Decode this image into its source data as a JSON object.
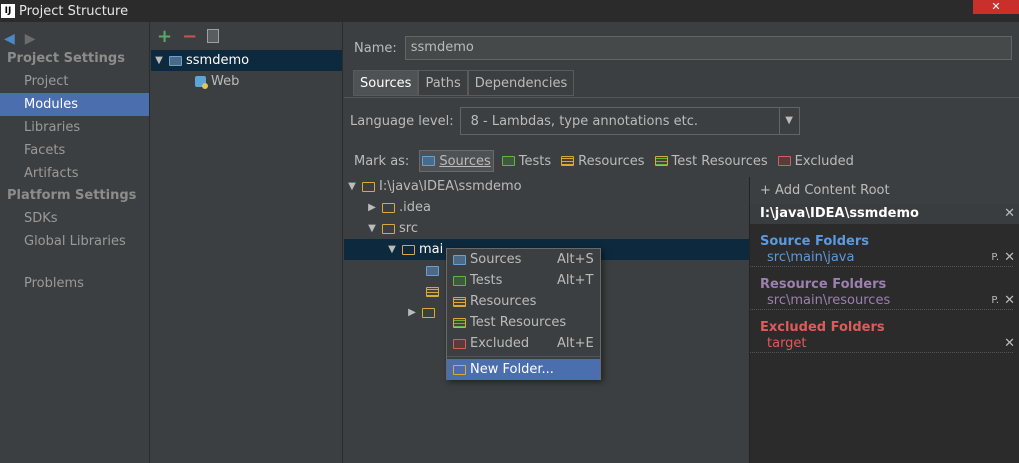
{
  "window": {
    "title": "Project Structure",
    "logo": "IJ",
    "close": "✕"
  },
  "left_nav": {
    "sections": [
      {
        "title": "Project Settings",
        "items": [
          "Project",
          "Modules",
          "Libraries",
          "Facets",
          "Artifacts"
        ]
      },
      {
        "title": "Platform Settings",
        "items": [
          "SDKs",
          "Global Libraries"
        ]
      }
    ],
    "extra": "Problems",
    "active": "Modules"
  },
  "modules": {
    "root": "ssmdemo",
    "child": "Web"
  },
  "main": {
    "name_label": "Name:",
    "name_value": "ssmdemo",
    "tabs": [
      "Sources",
      "Paths",
      "Dependencies"
    ],
    "active_tab": "Sources",
    "language_label": "Language level:",
    "language_value": "8 - Lambdas, type annotations etc.",
    "mark_as_label": "Mark as:",
    "mark_buttons": [
      "Sources",
      "Tests",
      "Resources",
      "Test Resources",
      "Excluded"
    ]
  },
  "source_tree": {
    "root": "I:\\java\\IDEA\\ssmdemo",
    "idea": ".idea",
    "src": "src",
    "main": "mai"
  },
  "content_root": {
    "add_label": "+ Add Content Root",
    "path": "I:\\java\\IDEA\\ssmdemo",
    "source_title": "Source Folders",
    "source_entry": "src\\main\\java",
    "resource_title": "Resource Folders",
    "resource_entry": "src\\main\\resources",
    "excluded_title": "Excluded Folders",
    "excluded_entry": "target"
  },
  "context_menu": {
    "items": [
      {
        "label": "Sources",
        "shortcut": "Alt+S"
      },
      {
        "label": "Tests",
        "shortcut": "Alt+T"
      },
      {
        "label": "Resources",
        "shortcut": ""
      },
      {
        "label": "Test Resources",
        "shortcut": ""
      },
      {
        "label": "Excluded",
        "shortcut": "Alt+E"
      }
    ],
    "new_folder": "New Folder..."
  },
  "colors": {
    "accent": "#4b6eaf",
    "source_blue": "#5a9ae0",
    "resource_purple": "#9d7fb0",
    "excluded_red": "#e05a5a"
  }
}
